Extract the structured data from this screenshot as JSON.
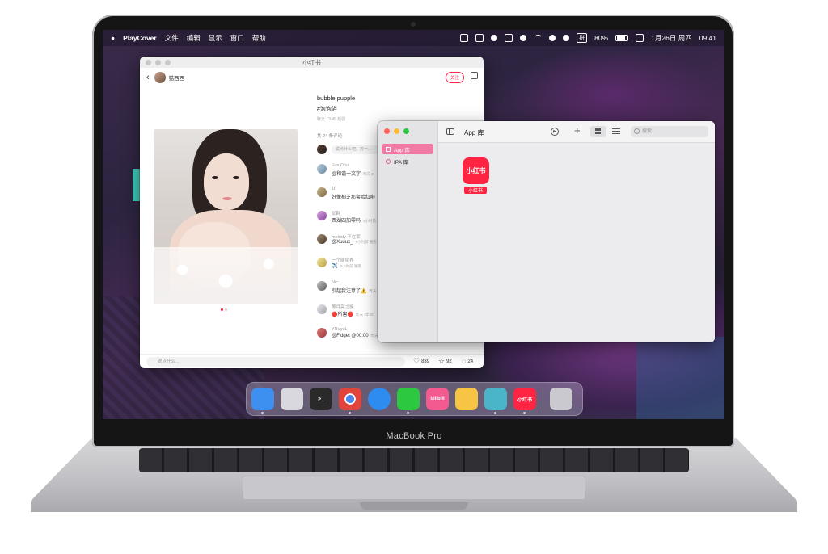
{
  "device": {
    "label": "MacBook Pro"
  },
  "menubar": {
    "app_name": "PlayCover",
    "menus": [
      "文件",
      "编辑",
      "显示",
      "窗口",
      "帮助"
    ],
    "battery": "80%",
    "date": "1月26日 周四",
    "time": "09:41"
  },
  "xhs_window": {
    "title": "小红书",
    "author": "猫西西",
    "follow_label": "关注",
    "post_title": "bubble pupple",
    "post_tag": "#泡泡浴",
    "post_time": "昨天 13:45 新疆",
    "comment_count": "共 24 条评论",
    "comment_placeholder": "说点什么吧。万一...",
    "comments": [
      {
        "name": "FunYYux",
        "text": "@和谐一文字",
        "meta": "昨天 2"
      },
      {
        "name": "1f",
        "text": "好像柏芝那套脸红啦",
        "meta": ""
      },
      {
        "name": "优群",
        "text": "西湖四加零吗",
        "meta": "2小时前"
      },
      {
        "name": "melody 不在家",
        "text": "@Xuuux_",
        "meta": "5小时前 重庆"
      },
      {
        "name": "一个能屈界",
        "text": "✈️",
        "meta": "3小时前 湖南"
      },
      {
        "name": "Nic",
        "text": "引起我注意了⚠️",
        "meta": "昨天"
      },
      {
        "name": "等月亮之族",
        "text": "🔴所害🔴",
        "meta": "昨天 23:43"
      },
      {
        "name": "YRuyuL",
        "text": "@Fidget @00:00",
        "meta": "昨天"
      }
    ],
    "say_placeholder": "说点什么...",
    "likes": "839",
    "stars": "92",
    "comments_total": "24"
  },
  "playcover_window": {
    "sidebar": [
      {
        "label": "App 库",
        "icon": "grid-icon",
        "active": true
      },
      {
        "label": "IPA 库",
        "icon": "circle-icon",
        "active": false
      }
    ],
    "title": "App 库",
    "search_placeholder": "搜索",
    "apps": [
      {
        "icon_text": "小红书",
        "label": "小红书"
      }
    ]
  },
  "dock": {
    "apps": [
      {
        "name": "finder-icon",
        "label": "",
        "color": "#3d8ff0"
      },
      {
        "name": "launchpad-icon",
        "label": "",
        "color": "#d8d8de"
      },
      {
        "name": "terminal-icon",
        "label": ">_",
        "color": "#2a2a2a"
      },
      {
        "name": "chrome-icon",
        "label": "",
        "color": "#e8e8e8"
      },
      {
        "name": "safari-icon",
        "label": "",
        "color": "#2e8cf0"
      },
      {
        "name": "wechat-icon",
        "label": "",
        "color": "#2bc840"
      },
      {
        "name": "bilibili-icon",
        "label": "bilibili",
        "color": "#f35a8f"
      },
      {
        "name": "sketch-icon",
        "label": "",
        "color": "#f7c444"
      },
      {
        "name": "playcover-icon",
        "label": "",
        "color": "#4ab5c9"
      },
      {
        "name": "xiaohongshu-icon",
        "label": "小红书",
        "color": "#ff2442"
      }
    ],
    "trash": {
      "name": "trash-icon",
      "color": "#c9c9cf"
    }
  }
}
